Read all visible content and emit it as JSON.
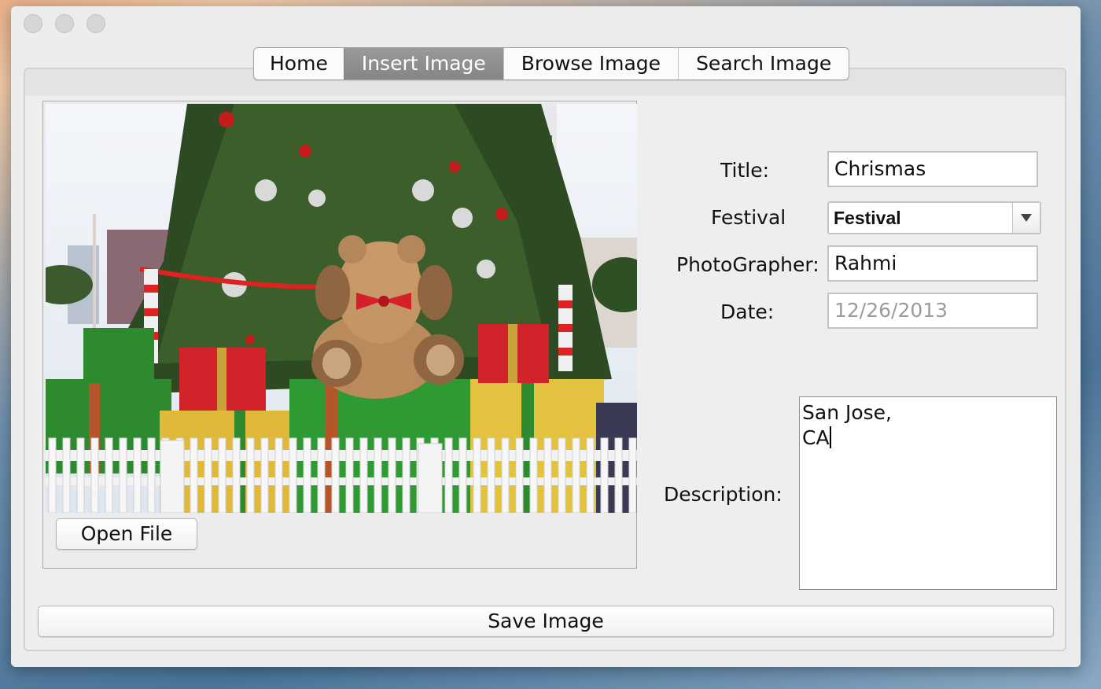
{
  "window": {
    "traffic_lights": [
      "close",
      "minimize",
      "zoom"
    ]
  },
  "tabs": [
    {
      "label": "Home",
      "active": false
    },
    {
      "label": "Insert Image",
      "active": true
    },
    {
      "label": "Browse Image",
      "active": false
    },
    {
      "label": "Search Image",
      "active": false
    }
  ],
  "image_panel": {
    "photo_alt": "photo-christmas-tree",
    "open_file_label": "Open File"
  },
  "form": {
    "title_label": "Title:",
    "title_value": "Chrismas",
    "festival_label": "Festival",
    "festival_selected": "Festival",
    "photographer_label": "PhotoGrapher:",
    "photographer_value": "Rahmi",
    "date_label": "Date:",
    "date_value": "12/26/2013",
    "description_label": "Description:",
    "description_lines": [
      "San Jose,",
      "CA"
    ]
  },
  "save_label": "Save Image",
  "colors": {
    "window_bg": "#ececec",
    "active_tab": "#8f8f8f"
  }
}
